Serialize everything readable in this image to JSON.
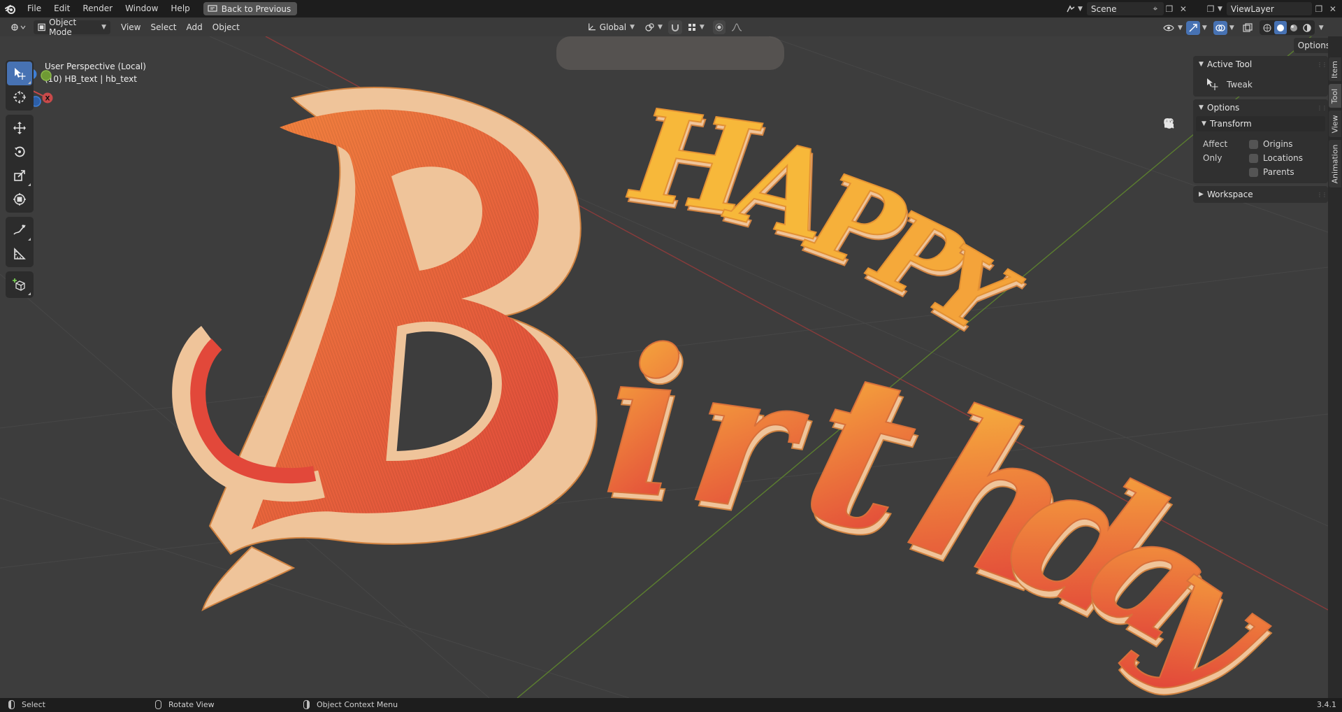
{
  "topbar": {
    "menus": [
      "File",
      "Edit",
      "Render",
      "Window",
      "Help"
    ],
    "back_button": "Back to Previous",
    "scene": "Scene",
    "view_layer": "ViewLayer"
  },
  "viewport_header": {
    "mode": "Object Mode",
    "menus": [
      "View",
      "Select",
      "Add",
      "Object"
    ],
    "transform_orientation": "Global",
    "options_label": "Options"
  },
  "viewport": {
    "perspective": "User Perspective (Local)",
    "object_info": "(10) HB_text | hb_text",
    "text_object": {
      "line1": "Happy",
      "line2": "Birthday"
    },
    "gizmo_axes": [
      "X",
      "Y",
      "Z"
    ]
  },
  "sidebar": {
    "tabs": [
      "Item",
      "Tool",
      "View",
      "Animation"
    ],
    "active_tab": "Tool",
    "active_tool_panel": "Active Tool",
    "active_tool_name": "Tweak",
    "options_panel": "Options",
    "transform_subpanel": "Transform",
    "affect_only_label": "Affect Only",
    "affect_options": [
      "Origins",
      "Locations",
      "Parents"
    ],
    "workspace_panel": "Workspace"
  },
  "statusbar": {
    "left_click": "Select",
    "middle_click": "Rotate View",
    "right_click": "Object Context Menu",
    "version": "3.4.1"
  },
  "colors": {
    "accent_blue": "#4772b3",
    "letter_face_top": "#f6b437",
    "letter_face_bottom": "#e5503c",
    "letter_side": "#efc49a",
    "axis_x": "#c94a4a",
    "axis_y": "#7aa83c",
    "axis_z": "#3f7fd6"
  }
}
